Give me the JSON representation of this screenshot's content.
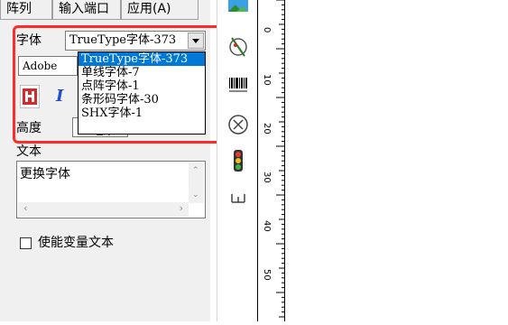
{
  "tabs": [
    {
      "label": "阵列"
    },
    {
      "label": "输入端口"
    },
    {
      "label": "应用(A)"
    }
  ],
  "font_label": "字体",
  "font_combo": {
    "value": "TrueType字体-373"
  },
  "adobe_field": {
    "value": "Adobe"
  },
  "dropdown_options": [
    {
      "label": "TrueType字体-373",
      "selected": true
    },
    {
      "label": "单线字体-7"
    },
    {
      "label": "点阵字体-1"
    },
    {
      "label": "条形码字体-30"
    },
    {
      "label": "SHX字体-1"
    }
  ],
  "height_label": "高度",
  "height_field": {
    "value": "10毫米"
  },
  "text_label": "文本",
  "text_content": "更换字体",
  "checkbox_label": "使能变量文本",
  "ruler_ticks": [
    "0",
    "10",
    "20",
    "30",
    "40",
    "50"
  ],
  "colors": {
    "highlight": "#0078d7",
    "red_frame": "#ff2b2b",
    "panel_bg": "#f0f0f0"
  },
  "icons": [
    "image-icon",
    "angle-icon",
    "barcode-icon",
    "timer-icon",
    "traffic-light-icon",
    "bracket-icon"
  ]
}
